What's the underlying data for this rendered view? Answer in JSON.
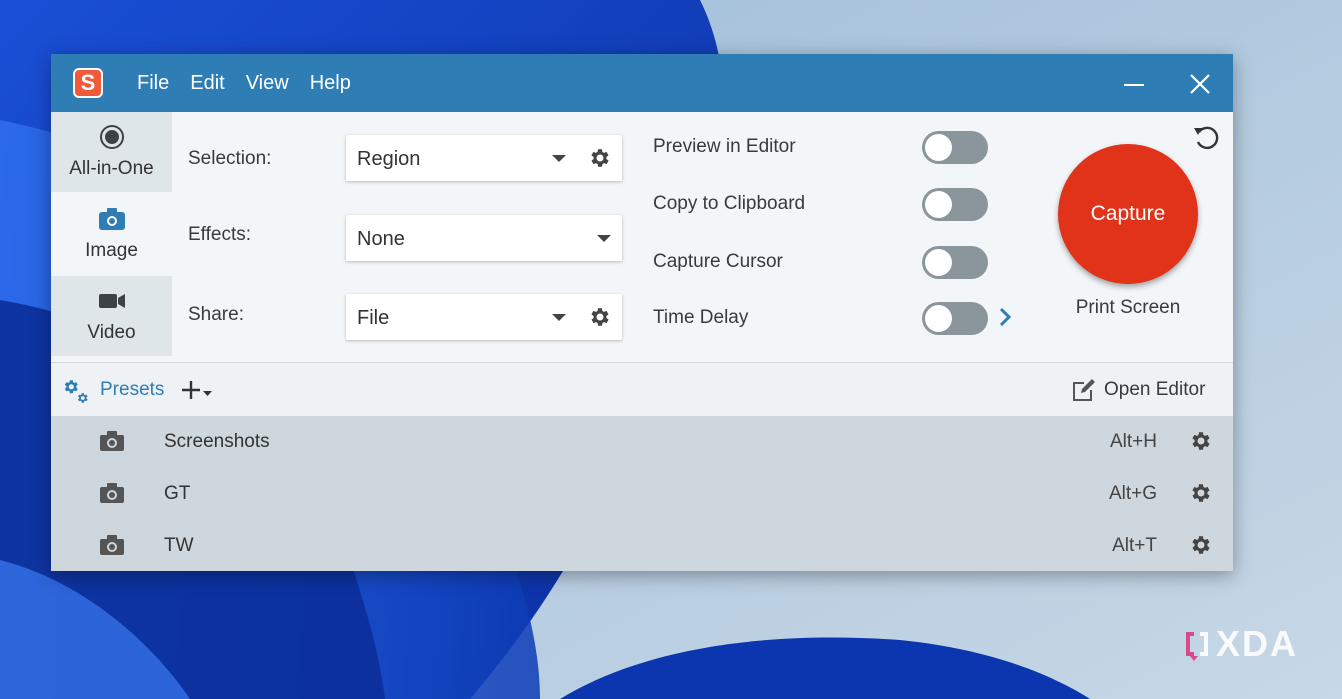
{
  "app": {
    "logo_letter": "S",
    "menu": [
      {
        "label": "File"
      },
      {
        "label": "Edit"
      },
      {
        "label": "View"
      },
      {
        "label": "Help"
      }
    ]
  },
  "tabs": [
    {
      "label": "All-in-One",
      "icon": "record-icon",
      "active": false
    },
    {
      "label": "Image",
      "icon": "camera-icon",
      "active": true
    },
    {
      "label": "Video",
      "icon": "video-camera-icon",
      "active": false
    }
  ],
  "settings": {
    "selection": {
      "label": "Selection:",
      "value": "Region"
    },
    "effects": {
      "label": "Effects:",
      "value": "None"
    },
    "share": {
      "label": "Share:",
      "value": "File"
    }
  },
  "options": [
    {
      "label": "Preview in Editor",
      "on": false
    },
    {
      "label": "Copy to Clipboard",
      "on": false
    },
    {
      "label": "Capture Cursor",
      "on": false
    },
    {
      "label": "Time Delay",
      "on": false
    }
  ],
  "capture": {
    "label": "Capture",
    "hotkey": "Print Screen"
  },
  "presets": {
    "label": "Presets",
    "open_editor": "Open Editor",
    "items": [
      {
        "name": "Screenshots",
        "hotkey": "Alt+H"
      },
      {
        "name": "GT",
        "hotkey": "Alt+G"
      },
      {
        "name": "TW",
        "hotkey": "Alt+T"
      }
    ]
  },
  "watermark": {
    "text": "XDA"
  },
  "colors": {
    "titlebar": "#2f7db5",
    "capture": "#e0331a",
    "accent": "#2f7db5",
    "toggle_off": "#8a959c"
  }
}
